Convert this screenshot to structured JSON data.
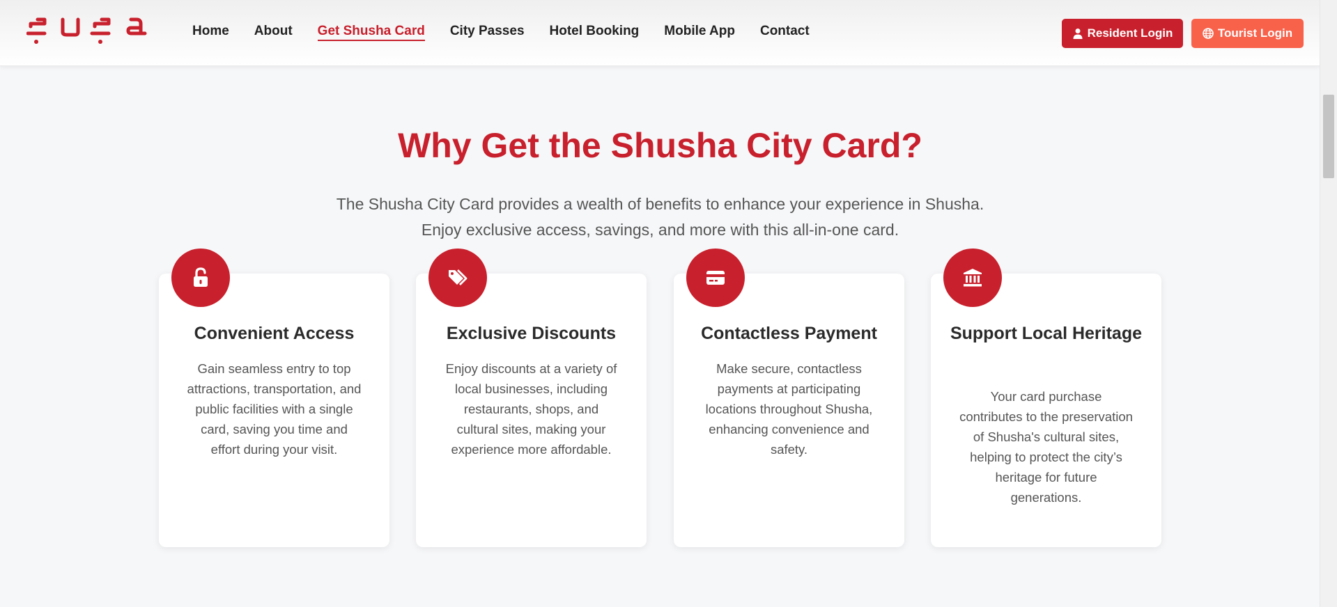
{
  "brand": {
    "logo_text": "şuşa"
  },
  "nav": {
    "items": [
      {
        "label": "Home",
        "active": false
      },
      {
        "label": "About",
        "active": false
      },
      {
        "label": "Get Shusha Card",
        "active": true
      },
      {
        "label": "City Passes",
        "active": false
      },
      {
        "label": "Hotel Booking",
        "active": false
      },
      {
        "label": "Mobile App",
        "active": false
      },
      {
        "label": "Contact",
        "active": false
      }
    ]
  },
  "auth": {
    "resident_label": "Resident Login",
    "resident_icon": "user-icon",
    "tourist_label": "Tourist Login",
    "tourist_icon": "globe-icon"
  },
  "section": {
    "title": "Why Get the Shusha City Card?",
    "subtitle_line1": "The Shusha City Card provides a wealth of benefits to enhance your experience in Shusha.",
    "subtitle_line2": "Enjoy exclusive access, savings, and more with this all-in-one card."
  },
  "cards": [
    {
      "icon": "unlock-icon",
      "title": "Convenient Access",
      "text": "Gain seamless entry to top attractions, transportation, and public facilities with a single card, saving you time and effort during your visit."
    },
    {
      "icon": "tags-icon",
      "title": "Exclusive Discounts",
      "text": "Enjoy discounts at a variety of local businesses, including restaurants, shops, and cultural sites, making your experience more affordable."
    },
    {
      "icon": "credit-card-icon",
      "title": "Contactless Payment",
      "text": "Make secure, contactless payments at participating locations throughout Shusha, enhancing convenience and safety."
    },
    {
      "icon": "landmark-icon",
      "title": "Support Local Heritage",
      "text": "Your card purchase contributes to the preservation of Shusha's cultural sites, helping to protect the city’s heritage for future generations."
    }
  ],
  "colors": {
    "brand_red": "#c8202c",
    "tourist_orange": "#f8614a",
    "page_bg": "#f6f7f9"
  }
}
